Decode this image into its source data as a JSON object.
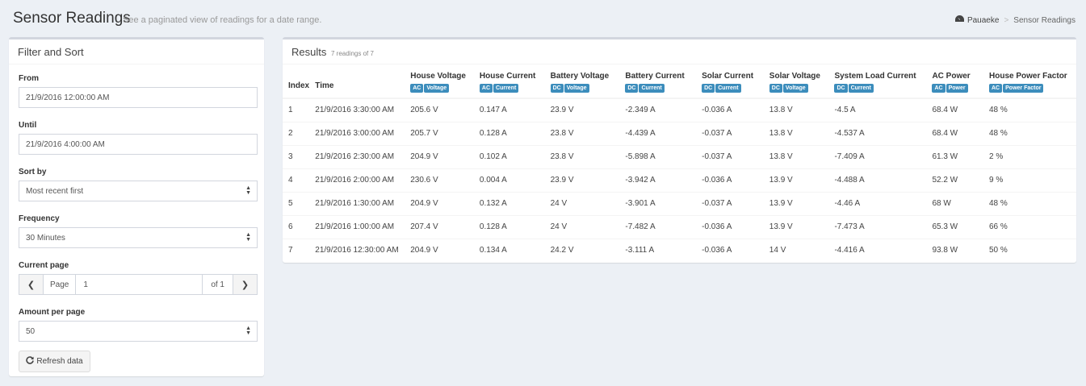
{
  "header": {
    "title": "Sensor Readings",
    "subtitle": "See a paginated view of readings for a date range.",
    "breadcrumb": [
      "Pauaeke",
      "Sensor Readings"
    ]
  },
  "filter": {
    "title": "Filter and Sort",
    "from_label": "From",
    "from_value": "21/9/2016 12:00:00 AM",
    "until_label": "Until",
    "until_value": "21/9/2016 4:00:00 AM",
    "sort_label": "Sort by",
    "sort_value": "Most recent first",
    "frequency_label": "Frequency",
    "frequency_value": "30 Minutes",
    "page_label": "Current page",
    "page_addon": "Page",
    "page_value": "1",
    "page_of": "of 1",
    "amount_label": "Amount per page",
    "amount_value": "50",
    "refresh_label": "Refresh data"
  },
  "results": {
    "title": "Results",
    "count": "7 readings of 7",
    "columns": [
      {
        "title": "Index",
        "badges": []
      },
      {
        "title": "Time",
        "badges": []
      },
      {
        "title": "House Voltage",
        "badges": [
          "AC",
          "Voltage"
        ]
      },
      {
        "title": "House Current",
        "badges": [
          "AC",
          "Current"
        ]
      },
      {
        "title": "Battery Voltage",
        "badges": [
          "DC",
          "Voltage"
        ]
      },
      {
        "title": "Battery Current",
        "badges": [
          "DC",
          "Current"
        ]
      },
      {
        "title": "Solar Current",
        "badges": [
          "DC",
          "Current"
        ]
      },
      {
        "title": "Solar Voltage",
        "badges": [
          "DC",
          "Voltage"
        ]
      },
      {
        "title": "System Load Current",
        "badges": [
          "DC",
          "Current"
        ]
      },
      {
        "title": "AC Power",
        "badges": [
          "AC",
          "Power"
        ]
      },
      {
        "title": "House Power Factor",
        "badges": [
          "AC",
          "Power Factor"
        ]
      }
    ],
    "rows": [
      [
        "1",
        "21/9/2016 3:30:00 AM",
        "205.6 V",
        "0.147 A",
        "23.9 V",
        "-2.349 A",
        "-0.036 A",
        "13.8 V",
        "-4.5 A",
        "68.4 W",
        "48 %"
      ],
      [
        "2",
        "21/9/2016 3:00:00 AM",
        "205.7 V",
        "0.128 A",
        "23.8 V",
        "-4.439 A",
        "-0.037 A",
        "13.8 V",
        "-4.537 A",
        "68.4 W",
        "48 %"
      ],
      [
        "3",
        "21/9/2016 2:30:00 AM",
        "204.9 V",
        "0.102 A",
        "23.8 V",
        "-5.898 A",
        "-0.037 A",
        "13.8 V",
        "-7.409 A",
        "61.3 W",
        "2 %"
      ],
      [
        "4",
        "21/9/2016 2:00:00 AM",
        "230.6 V",
        "0.004 A",
        "23.9 V",
        "-3.942 A",
        "-0.036 A",
        "13.9 V",
        "-4.488 A",
        "52.2 W",
        "9 %"
      ],
      [
        "5",
        "21/9/2016 1:30:00 AM",
        "204.9 V",
        "0.132 A",
        "24 V",
        "-3.901 A",
        "-0.037 A",
        "13.9 V",
        "-4.46 A",
        "68 W",
        "48 %"
      ],
      [
        "6",
        "21/9/2016 1:00:00 AM",
        "207.4 V",
        "0.128 A",
        "24 V",
        "-7.482 A",
        "-0.036 A",
        "13.9 V",
        "-7.473 A",
        "65.3 W",
        "66 %"
      ],
      [
        "7",
        "21/9/2016 12:30:00 AM",
        "204.9 V",
        "0.134 A",
        "24.2 V",
        "-3.111 A",
        "-0.036 A",
        "14 V",
        "-4.416 A",
        "93.8 W",
        "50 %"
      ]
    ]
  },
  "colors": {
    "background": "#ecf0f5",
    "badge": "#3c8dbc",
    "box_border": "#d2d6de"
  },
  "icons": {
    "breadcrumb": "dashboard-icon",
    "refresh": "refresh-icon",
    "prev": "chevron-left-icon",
    "next": "chevron-right-icon"
  }
}
